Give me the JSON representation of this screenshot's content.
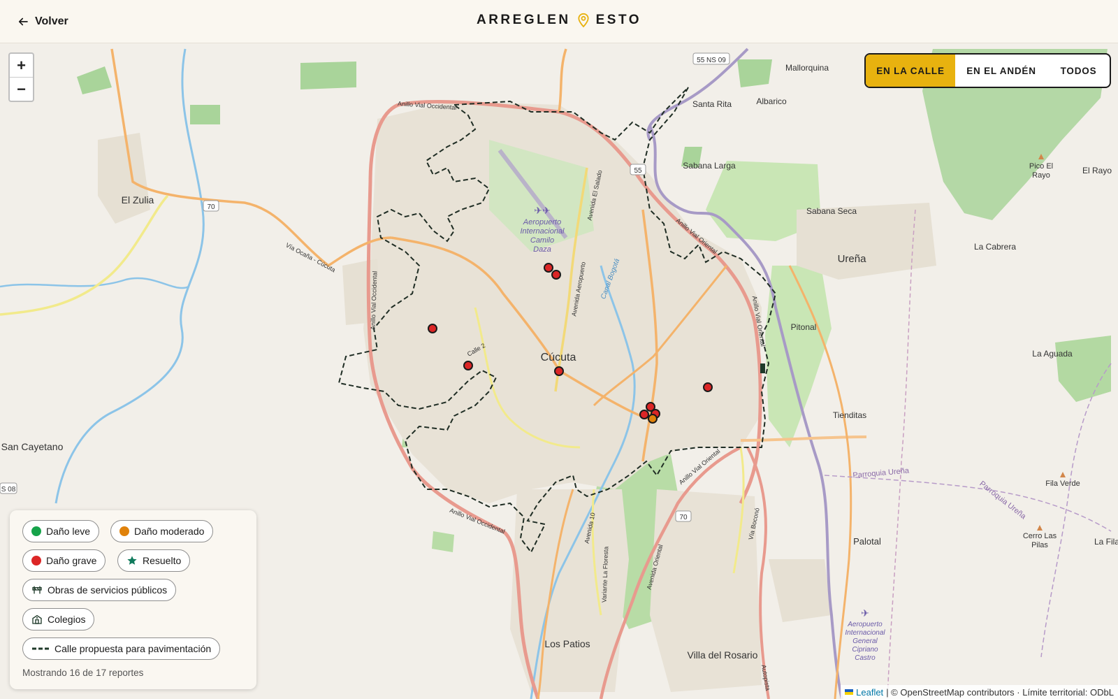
{
  "header": {
    "back_label": "Volver",
    "brand_left": "ARREGLEN",
    "brand_right": "ESTO"
  },
  "zoom": {
    "in_label": "+",
    "out_label": "−"
  },
  "view_toggle": {
    "options": [
      "EN LA CALLE",
      "EN EL ANDÉN",
      "TODOS"
    ],
    "selected": "EN LA CALLE",
    "accent": "#e8b20f"
  },
  "legend": {
    "items": [
      {
        "label": "Daño leve",
        "color": "#16a34a"
      },
      {
        "label": "Daño moderado",
        "color": "#e0820b"
      },
      {
        "label": "Daño grave",
        "color": "#dc2626"
      },
      {
        "label": "Resuelto",
        "color": "#0f7a5c"
      },
      {
        "label": "Obras de servicios públicos"
      },
      {
        "label": "Colegios"
      },
      {
        "label": "Calle propuesta para pavimentación"
      }
    ],
    "count_text": "Mostrando 16 de 17 reportes"
  },
  "attribution": {
    "leaflet": "Leaflet",
    "rest": "| © OpenStreetMap contributors · Límite territorial: ODbL"
  },
  "map_labels": {
    "cucuta": "Cúcuta",
    "el_zulia": "El Zulia",
    "san_cayetano": "San Cayetano",
    "los_patios": "Los Patios",
    "villa_rosario": "Villa del Rosario",
    "urena": "Ureña",
    "mallorquina": "Mallorquina",
    "santa_rita": "Santa Rita",
    "albarico": "Albarico",
    "sabana_larga": "Sabana Larga",
    "sabana_seca": "Sabana Seca",
    "la_cabrera": "La Cabrera",
    "pitonal": "Pitonal",
    "la_aguada": "La Aguada",
    "tienditas": "Tienditas",
    "palotal": "Palotal",
    "pico_rayo_1": "Pico El",
    "pico_rayo_2": "Rayo",
    "el_rayo": "El Rayo",
    "fila_verde": "Fila Verde",
    "cerro_1": "Cerro Las",
    "cerro_2": "Pilas",
    "la_fila": "La Fila",
    "aero1_1": "Aeropuerto",
    "aero1_2": "Internacional",
    "aero1_3": "Camilo",
    "aero1_4": "Daza",
    "aero2_1": "Aeropuerto",
    "aero2_2": "Internacional",
    "aero2_3": "General",
    "aero2_4": "Cipriano",
    "aero2_5": "Castro",
    "anillo_occ": "Anillo Vial Occidental",
    "anillo_occ2": "Anillo Vial Occidental",
    "anillo_ori": "Anillo Vial Oriental",
    "anillo_ori2": "Anillo Vial Oriental",
    "anillo_ori3": "Anillo Vial Oriental",
    "via_ocana": "Vía Ocaña - Cúcuta",
    "av_aeropuerto": "Avenida Aeropuerto",
    "av_salado": "Avenida El Salado",
    "canal_bogota": "Canal Bogotá",
    "calle2": "Calle 2",
    "av10": "Avenida 10",
    "variante": "Variante La Floresta",
    "av_oriental": "Avenida Oriental",
    "via_boconó": "Vía Boconó",
    "parroquia_urena": "Parroquia Ureña",
    "parroquia_urena2": "Parroquia Ureña",
    "autopista": "Autopista",
    "r70": "70",
    "r55": "55",
    "r55ns": "55 NS 09",
    "r70b": "70",
    "rs08": "S 08"
  }
}
